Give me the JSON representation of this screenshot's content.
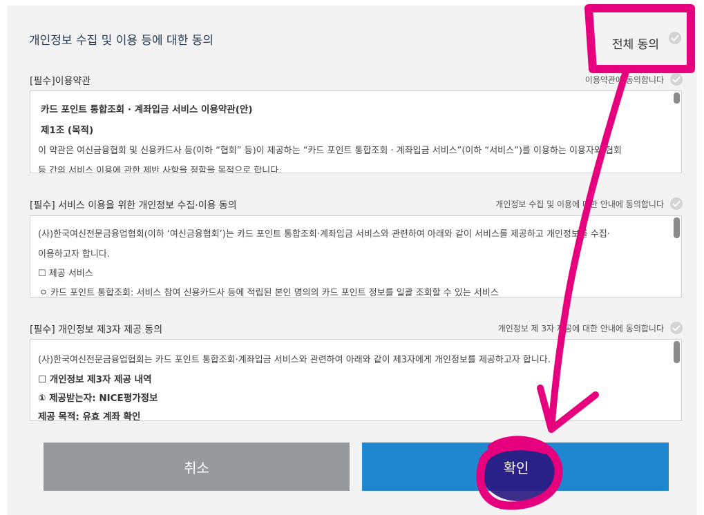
{
  "title": "개인정보 수집 및 이용 등에 대한 동의",
  "all_agree": "전체 동의",
  "sections": [
    {
      "label": "[필수]이용약관",
      "agree": "이용약관에 동의합니다",
      "lines": [
        "카드 포인트 통합조회 · 계좌입금 서비스 이용약관(안)",
        "제1조 (목적)",
        "이 약관은 여신금융협회 및 신용카드사 등(이하 “협회” 등)이 제공하는 “카드 포인트 통합조회 · 계좌입금 서비스”(이하 “서비스”)를 이용하는 이용자와 협회",
        "등 간의 서비스 이용에 관한 제반 사항을 정함을 목적으로 합니다."
      ]
    },
    {
      "label": "[필수] 서비스 이용을 위한 개인정보 수집·이용 동의",
      "agree": "개인정보 수집 및 이용에 대한 안내에 동의합니다",
      "lines": [
        "(사)한국여신전문금융업협회(이하 ‘여신금융협회’)는 카드 포인트 통합조회·계좌입금 서비스와 관련하여 아래와 같이 서비스를 제공하고 개인정보를 수집·",
        "이용하고자 합니다.",
        "☐ 제공 서비스",
        "ㅇ 카드 포인트 통합조회: 서비스 참여 신용카드사 등에 적립된 본인 명의의 카드 포인트 정보를 일괄 조회할 수 있는 서비스"
      ]
    },
    {
      "label": "[필수] 개인정보 제3자 제공 동의",
      "agree": "개인정보 제 3자 제공에 대한 안내에 동의합니다",
      "lines": [
        "(사)한국여신전문금융업협회는 카드 포인트 통합조회·계좌입금 서비스와 관련하여 아래와 같이 제3자에게 개인정보를 제공하고자 합니다.",
        "☐ 개인정보 제3자 제공 내역",
        "① 제공받는자: NICE평가정보",
        "제공 목적: 유효 계좌 확인"
      ]
    }
  ],
  "buttons": {
    "cancel": "취소",
    "confirm": "확인"
  },
  "colors": {
    "confirm": "#1e87d0",
    "cancel": "#969a9d",
    "annotation": "#e6007e"
  }
}
